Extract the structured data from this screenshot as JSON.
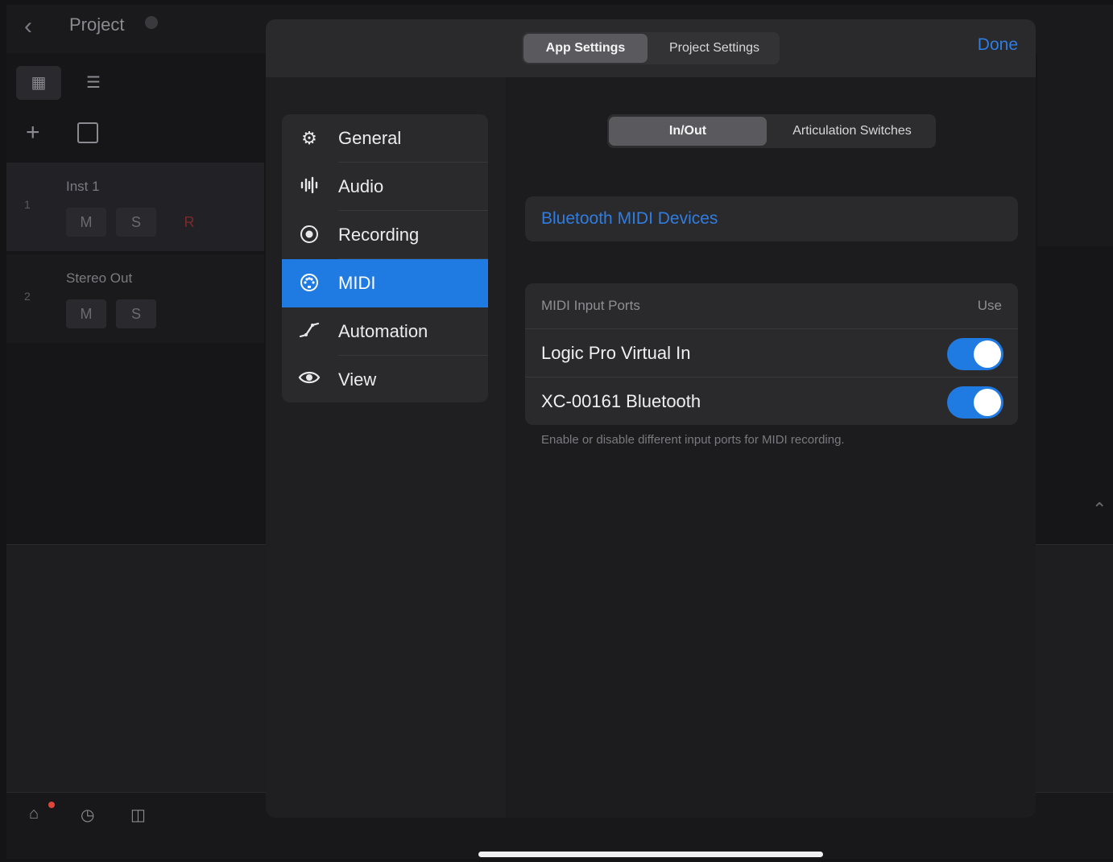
{
  "background": {
    "project_title": "Project",
    "tracks": [
      {
        "number": "1",
        "name": "Inst 1",
        "buttons": [
          "M",
          "S",
          "R"
        ]
      },
      {
        "number": "2",
        "name": "Stereo Out",
        "buttons": [
          "M",
          "S"
        ]
      }
    ]
  },
  "sheet": {
    "tabs": [
      {
        "label": "App Settings",
        "selected": true
      },
      {
        "label": "Project Settings",
        "selected": false
      }
    ],
    "done_label": "Done",
    "sidebar": {
      "items": [
        {
          "label": "General",
          "icon": "gear-icon"
        },
        {
          "label": "Audio",
          "icon": "waveform-icon"
        },
        {
          "label": "Recording",
          "icon": "record-icon"
        },
        {
          "label": "MIDI",
          "icon": "midi-port-icon",
          "selected": true
        },
        {
          "label": "Automation",
          "icon": "automation-curve-icon"
        },
        {
          "label": "View",
          "icon": "eye-icon"
        }
      ]
    },
    "midi_tabs": [
      {
        "label": "In/Out",
        "selected": true
      },
      {
        "label": "Articulation Switches",
        "selected": false
      }
    ],
    "bluetooth_link": "Bluetooth MIDI Devices",
    "ports": {
      "title": "MIDI Input Ports",
      "use_label": "Use",
      "rows": [
        {
          "label": "Logic Pro Virtual In",
          "enabled": true
        },
        {
          "label": "XC-00161 Bluetooth",
          "enabled": true
        }
      ],
      "note": "Enable or disable different input ports for MIDI recording."
    }
  },
  "colors": {
    "accent": "#1f7be2",
    "link": "#2f7de0",
    "sheet_bg": "#1c1c1e",
    "group_bg": "#2a2a2d"
  }
}
